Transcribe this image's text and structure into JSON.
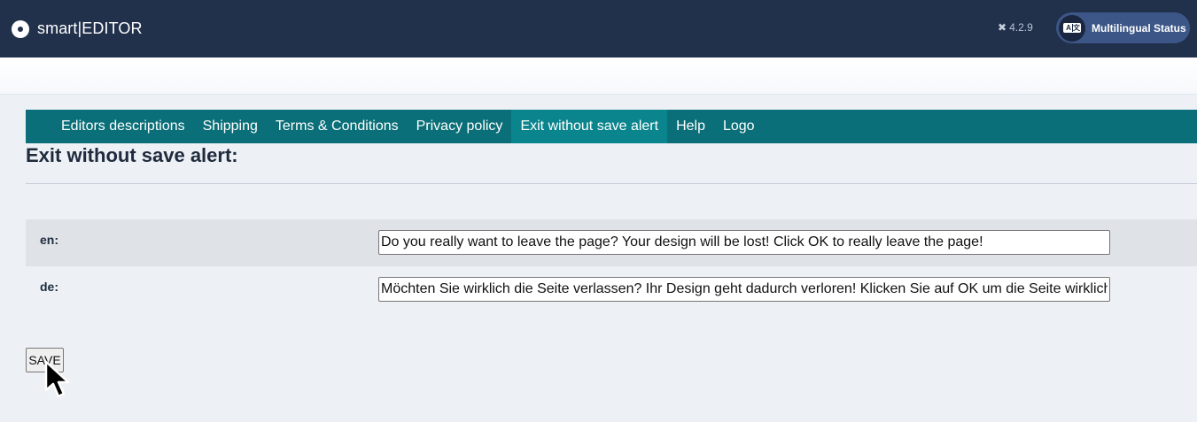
{
  "header": {
    "brand": "smart|EDITOR",
    "version": "4.2.9",
    "version_icon": "joomla-icon",
    "multilingual_status_label": "Multilingual Status",
    "multilingual_icon_left": "A",
    "multilingual_icon_right": "文"
  },
  "tabs": [
    {
      "label": "Editors descriptions",
      "active": false
    },
    {
      "label": "Shipping",
      "active": false
    },
    {
      "label": "Terms & Conditions",
      "active": false
    },
    {
      "label": "Privacy policy",
      "active": false
    },
    {
      "label": "Exit without save alert",
      "active": true
    },
    {
      "label": "Help",
      "active": false
    },
    {
      "label": "Logo",
      "active": false
    }
  ],
  "page": {
    "title": "Exit without save alert:"
  },
  "fields": [
    {
      "lang": "en:",
      "value": "Do you really want to leave the page? Your design will be lost! Click OK to really leave the page!"
    },
    {
      "lang": "de:",
      "value": "Möchten Sie wirklich die Seite verlassen? Ihr Design geht dadurch verloren! Klicken Sie auf OK um die Seite wirklich zu verlassen!"
    }
  ],
  "actions": {
    "save_label": "SAVE"
  },
  "colors": {
    "header_bg": "#21304b",
    "tab_bg": "#0a6f78",
    "tab_active_bg": "#0b858d",
    "page_bg": "#edf1f6"
  }
}
